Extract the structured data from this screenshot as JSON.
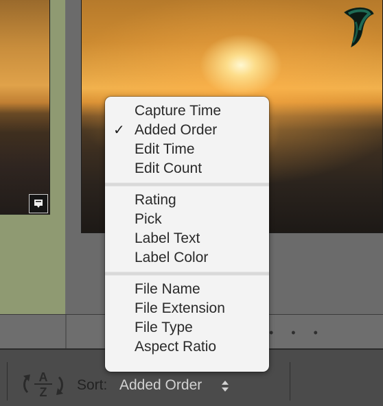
{
  "sort_menu": {
    "groups": [
      [
        {
          "label": "Capture Time",
          "checked": false
        },
        {
          "label": "Added Order",
          "checked": true
        },
        {
          "label": "Edit Time",
          "checked": false
        },
        {
          "label": "Edit Count",
          "checked": false
        }
      ],
      [
        {
          "label": "Rating",
          "checked": false
        },
        {
          "label": "Pick",
          "checked": false
        },
        {
          "label": "Label Text",
          "checked": false
        },
        {
          "label": "Label Color",
          "checked": false
        }
      ],
      [
        {
          "label": "File Name",
          "checked": false
        },
        {
          "label": "File Extension",
          "checked": false
        },
        {
          "label": "File Type",
          "checked": false
        },
        {
          "label": "Aspect Ratio",
          "checked": false
        }
      ]
    ],
    "check_glyph": "✓"
  },
  "toolbar": {
    "sort_label": "Sort:",
    "sort_value": "Added Order",
    "sort_direction_icon": "sort-az-icon",
    "dropdown_icon": "updown-arrows-icon"
  },
  "colors": {
    "menu_bg": "#f3f3f3",
    "toolbar_bg": "#4b4b4b",
    "selected_cell_bg": "#8f9a72"
  }
}
